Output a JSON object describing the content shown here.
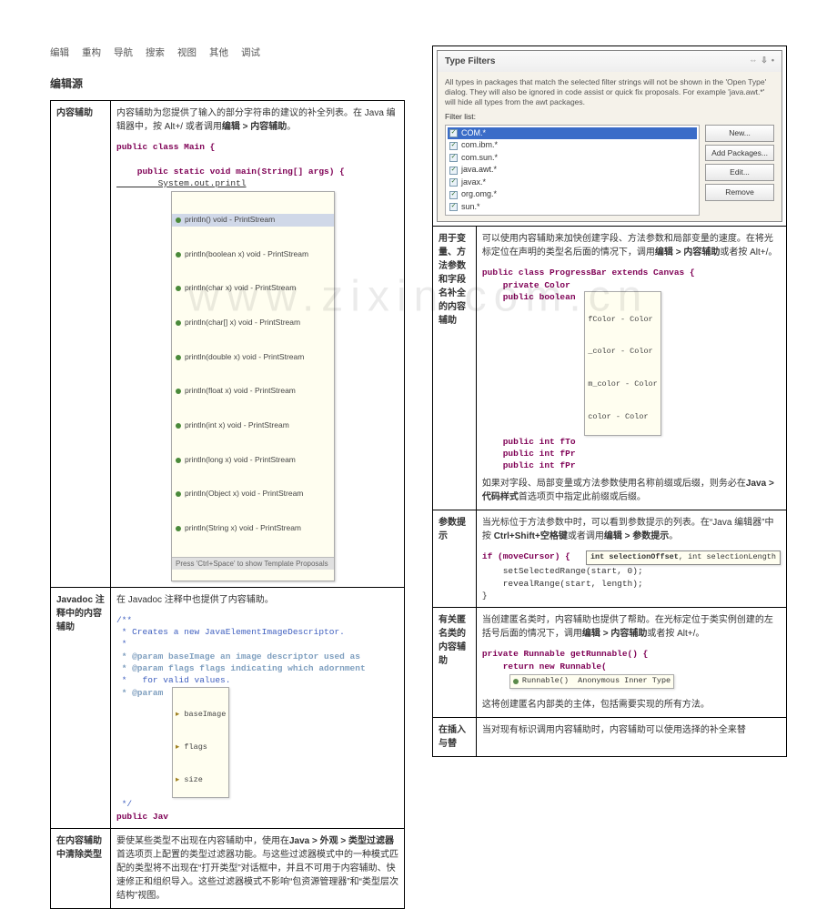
{
  "tabs": [
    "编辑",
    "重构",
    "导航",
    "搜索",
    "视图",
    "其他",
    "调试"
  ],
  "section_title_left": "编辑源",
  "watermark": "www.zixin.com.cn",
  "left": {
    "r1": {
      "label": "内容辅助",
      "desc1": "内容辅助为您提供了输入的部分字符串的建议的补全列表。在 Java 编辑器中，按 Alt+/ 或者调用",
      "desc1b": "编辑 > 内容辅助",
      "desc1c": "。",
      "code1": "public class Main {",
      "code2": "    public static void main(String[] args) {",
      "code3": "        System.out.printl",
      "code4": "    }",
      "code5": "}",
      "assist": [
        "println() void - PrintStream",
        "println(boolean x) void - PrintStream",
        "println(char x) void - PrintStream",
        "println(char[] x) void - PrintStream",
        "println(double x) void - PrintStream",
        "println(float x) void - PrintStream",
        "println(int x) void - PrintStream",
        "println(long x) void - PrintStream",
        "println(Object x) void - PrintStream",
        "println(String x) void - PrintStream"
      ],
      "assist_hint": "Press 'Ctrl+Space' to show Template Proposals"
    },
    "r2": {
      "label": "Javadoc 注释中的内容辅助",
      "desc": "在 Javadoc 注释中也提供了内容辅助。",
      "c1": "/**",
      "c2": " * Creates a new JavaElementImageDescriptor.",
      "c3": " *",
      "c4": " * @param baseImage an image descriptor used as",
      "c5": " * @param flags flags indicating which adornment",
      "c6": " *   for valid values.",
      "c7": " * @param ",
      "c8": " */",
      "c9": "public Jav",
      "assist": [
        "baseImage",
        "flags",
        "size"
      ]
    },
    "r3": {
      "label": "在内容辅助中清除类型",
      "desc1": "要使某些类型不出现在内容辅助中，使用在",
      "desc1b": "Java > 外观 > 类型过滤器",
      "desc1c": "首选项页上配置的类型过滤器功能。与这些过滤器模式中的一种模式匹配的类型将不出现在“打开类型”对话框中，并且不可用于内容辅助、快速修正和组织导入。这些过滤器模式不影响“包资源管理器”和“类型层次结构”视图。"
    }
  },
  "right": {
    "dialog": {
      "title": "Type Filters",
      "note": "All types in packages that match the selected filter strings will not be shown in the 'Open Type' dialog. They will also be ignored in code assist or quick fix proposals. For example 'java.awt.*' will hide all types from the awt packages.",
      "filter_label": "Filter list:",
      "items": [
        "COM.*",
        "com.ibm.*",
        "com.sun.*",
        "java.awt.*",
        "javax.*",
        "org.omg.*",
        "sun.*"
      ],
      "btns": [
        "New...",
        "Add Packages...",
        "Edit...",
        "Remove"
      ],
      "ctrl1": "⇔",
      "ctrl2": "⇩",
      "ctrl3": "•"
    },
    "r1": {
      "label": "用于变量、方法参数和字段名补全的内容辅助",
      "desc1": "可以使用内容辅助来加快创建字段、方法参数和局部变量的速度。在将光标定位在声明的类型名后面的情况下，调用",
      "desc1b": "编辑 > 内容辅助",
      "desc1c": "或者按 Alt+/。",
      "code1": "public class ProgressBar extends Canvas {",
      "code2": "    private Color ",
      "code3": "    public boolean ",
      "code4": "    public int fTo",
      "code5": "    public int fPr",
      "code6": "    public int fPr",
      "assist": [
        "fColor - Color",
        "_color - Color",
        "m_color - Color",
        "color - Color"
      ],
      "tail1": "如果对字段、局部变量或方法参数使用名称前缀或后缀，则务必在",
      "tail1b": "Java > 代码样式",
      "tail1c": "首选项页中指定此前缀或后缀。"
    },
    "r2": {
      "label": "参数提示",
      "desc1": "当光标位于方法参数中时，可以看到参数提示的列表。在“Java 编辑器”中按 ",
      "desc1b": "Ctrl+Shift+空格键",
      "desc1c": "或者调用",
      "desc1d": "编辑 > 参数提示",
      "desc1e": "。",
      "code1": "if (moveCursor) {",
      "code2": "    setSelectedRange(start, 0);",
      "code3": "    revealRange(start, length);",
      "code4": "}",
      "tooltip": "int selectionOffset, int selectionLength"
    },
    "r3": {
      "label": "有关匿名类的内容辅助",
      "desc1": "当创建匿名类时，内容辅助也提供了帮助。在光标定位于类实例创建的左括号后面的情况下，调用",
      "desc1b": "编辑 > 内容辅助",
      "desc1c": "或者按 Alt+/。",
      "code1": "private Runnable getRunnable() {",
      "code2": "    return new Runnable(",
      "assist": "Runnable()  Anonymous Inner Type",
      "tail": "这将创建匿名内部类的主体，包括需要实现的所有方法。"
    },
    "r4": {
      "label": "在插入与替",
      "desc": "当对现有标识调用内容辅助时，内容辅助可以使用选择的补全来替"
    }
  }
}
